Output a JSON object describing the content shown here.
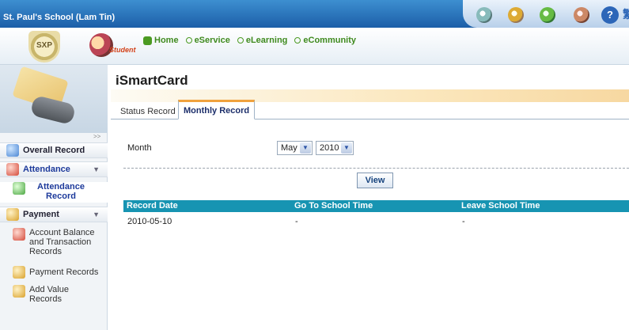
{
  "app": {
    "school_name": "St. Paul's School (Lam Tin)"
  },
  "header": {
    "crest_text": "SXP",
    "role_label": "Student",
    "nav": [
      "Home",
      "eService",
      "eLearning",
      "eCommunity"
    ],
    "top_icons": [
      "tool-icon",
      "settings-icon",
      "home-icon",
      "calendar-icon",
      "help-icon",
      "language-icon"
    ],
    "help_glyph": "?",
    "language_glyph": "繁"
  },
  "sidebar": {
    "collapse_glyph": ">>",
    "overall": "Overall Record",
    "attendance_section": "Attendance",
    "attendance_items": [
      "Attendance Record"
    ],
    "payment_section": "Payment",
    "payment_items": [
      "Account Balance and Transaction Records",
      "Payment Records",
      "Add Value Records"
    ]
  },
  "main": {
    "title": "iSmartCard",
    "tabs": [
      "Status Record",
      "Monthly Record"
    ],
    "active_tab": "Monthly Record",
    "month_label": "Month",
    "month_value": "May",
    "year_value": "2010",
    "view_button": "View",
    "table": {
      "headers": [
        "Record Date",
        "Go To School Time",
        "Leave School Time"
      ],
      "rows": [
        [
          "2010-05-10",
          "-",
          "-"
        ]
      ]
    }
  },
  "colors": {
    "topbar": "#1c5ea8",
    "table_header": "#1794b2",
    "nav_green": "#3f8a1e",
    "tab_accent": "#f0a23e"
  }
}
